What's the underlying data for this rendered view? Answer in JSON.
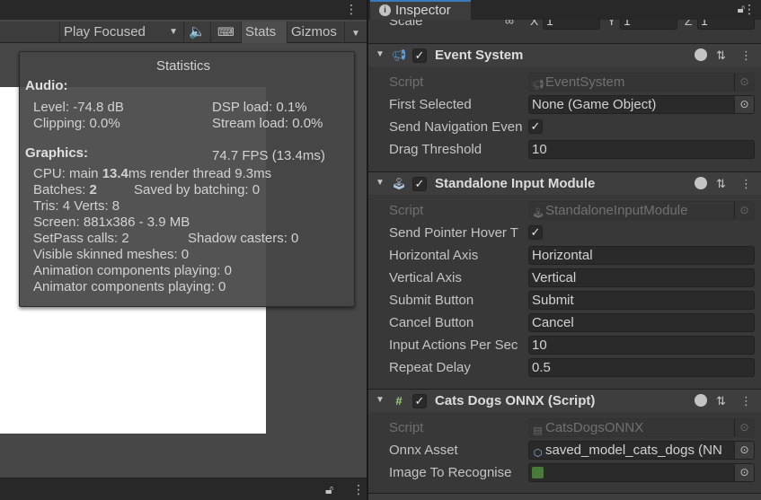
{
  "game_view": {
    "toolbar": {
      "play_mode": "Play Focused",
      "stats_label": "Stats",
      "gizmos_label": "Gizmos"
    },
    "statistics": {
      "title": "Statistics",
      "audio_header": "Audio:",
      "level": "Level: -74.8 dB",
      "dsp_load": "DSP load: 0.1%",
      "clipping": "Clipping: 0.0%",
      "stream_load": "Stream load: 0.0%",
      "graphics_header": "Graphics:",
      "fps": "74.7 FPS (13.4ms)",
      "cpu_prefix": "CPU: main ",
      "cpu_main": "13.4",
      "cpu_suffix": "ms  render thread 9.3ms",
      "batches_prefix": "Batches: ",
      "batches_value": "2",
      "saved_by_batching": "Saved by batching: 0",
      "tris_verts": "Tris: 4  Verts: 8",
      "screen": "Screen: 881x386 - 3.9 MB",
      "setpass": "SetPass calls: 2",
      "shadow_casters": "Shadow casters: 0",
      "skinned_meshes": "Visible skinned meshes: 0",
      "animation_components": "Animation components playing: 0",
      "animator_components": "Animator components playing: 0"
    }
  },
  "inspector": {
    "tab_title": "Inspector",
    "scale_row": {
      "label": "Scale",
      "x_label": "X",
      "x_value": "1",
      "y_label": "Y",
      "y_value": "1",
      "z_label": "Z",
      "z_value": "1"
    },
    "event_system": {
      "title": "Event System",
      "script_label": "Script",
      "script_value": "EventSystem",
      "first_selected_label": "First Selected",
      "first_selected_value": "None (Game Object)",
      "send_nav_label": "Send Navigation Even",
      "send_nav_checked": true,
      "drag_threshold_label": "Drag Threshold",
      "drag_threshold_value": "10"
    },
    "standalone_input": {
      "title": "Standalone Input Module",
      "script_label": "Script",
      "script_value": "StandaloneInputModule",
      "send_pointer_label": "Send Pointer Hover T",
      "send_pointer_checked": true,
      "horizontal_axis_label": "Horizontal Axis",
      "horizontal_axis_value": "Horizontal",
      "vertical_axis_label": "Vertical Axis",
      "vertical_axis_value": "Vertical",
      "submit_label": "Submit Button",
      "submit_value": "Submit",
      "cancel_label": "Cancel Button",
      "cancel_value": "Cancel",
      "input_actions_label": "Input Actions Per Sec",
      "input_actions_value": "10",
      "repeat_delay_label": "Repeat Delay",
      "repeat_delay_value": "0.5"
    },
    "cats_dogs": {
      "title": "Cats Dogs ONNX (Script)",
      "script_label": "Script",
      "script_value": "CatsDogsONNX",
      "onnx_label": "Onnx Asset",
      "onnx_value": "saved_model_cats_dogs (NN",
      "image_label": "Image To Recognise",
      "image_value": ""
    }
  }
}
